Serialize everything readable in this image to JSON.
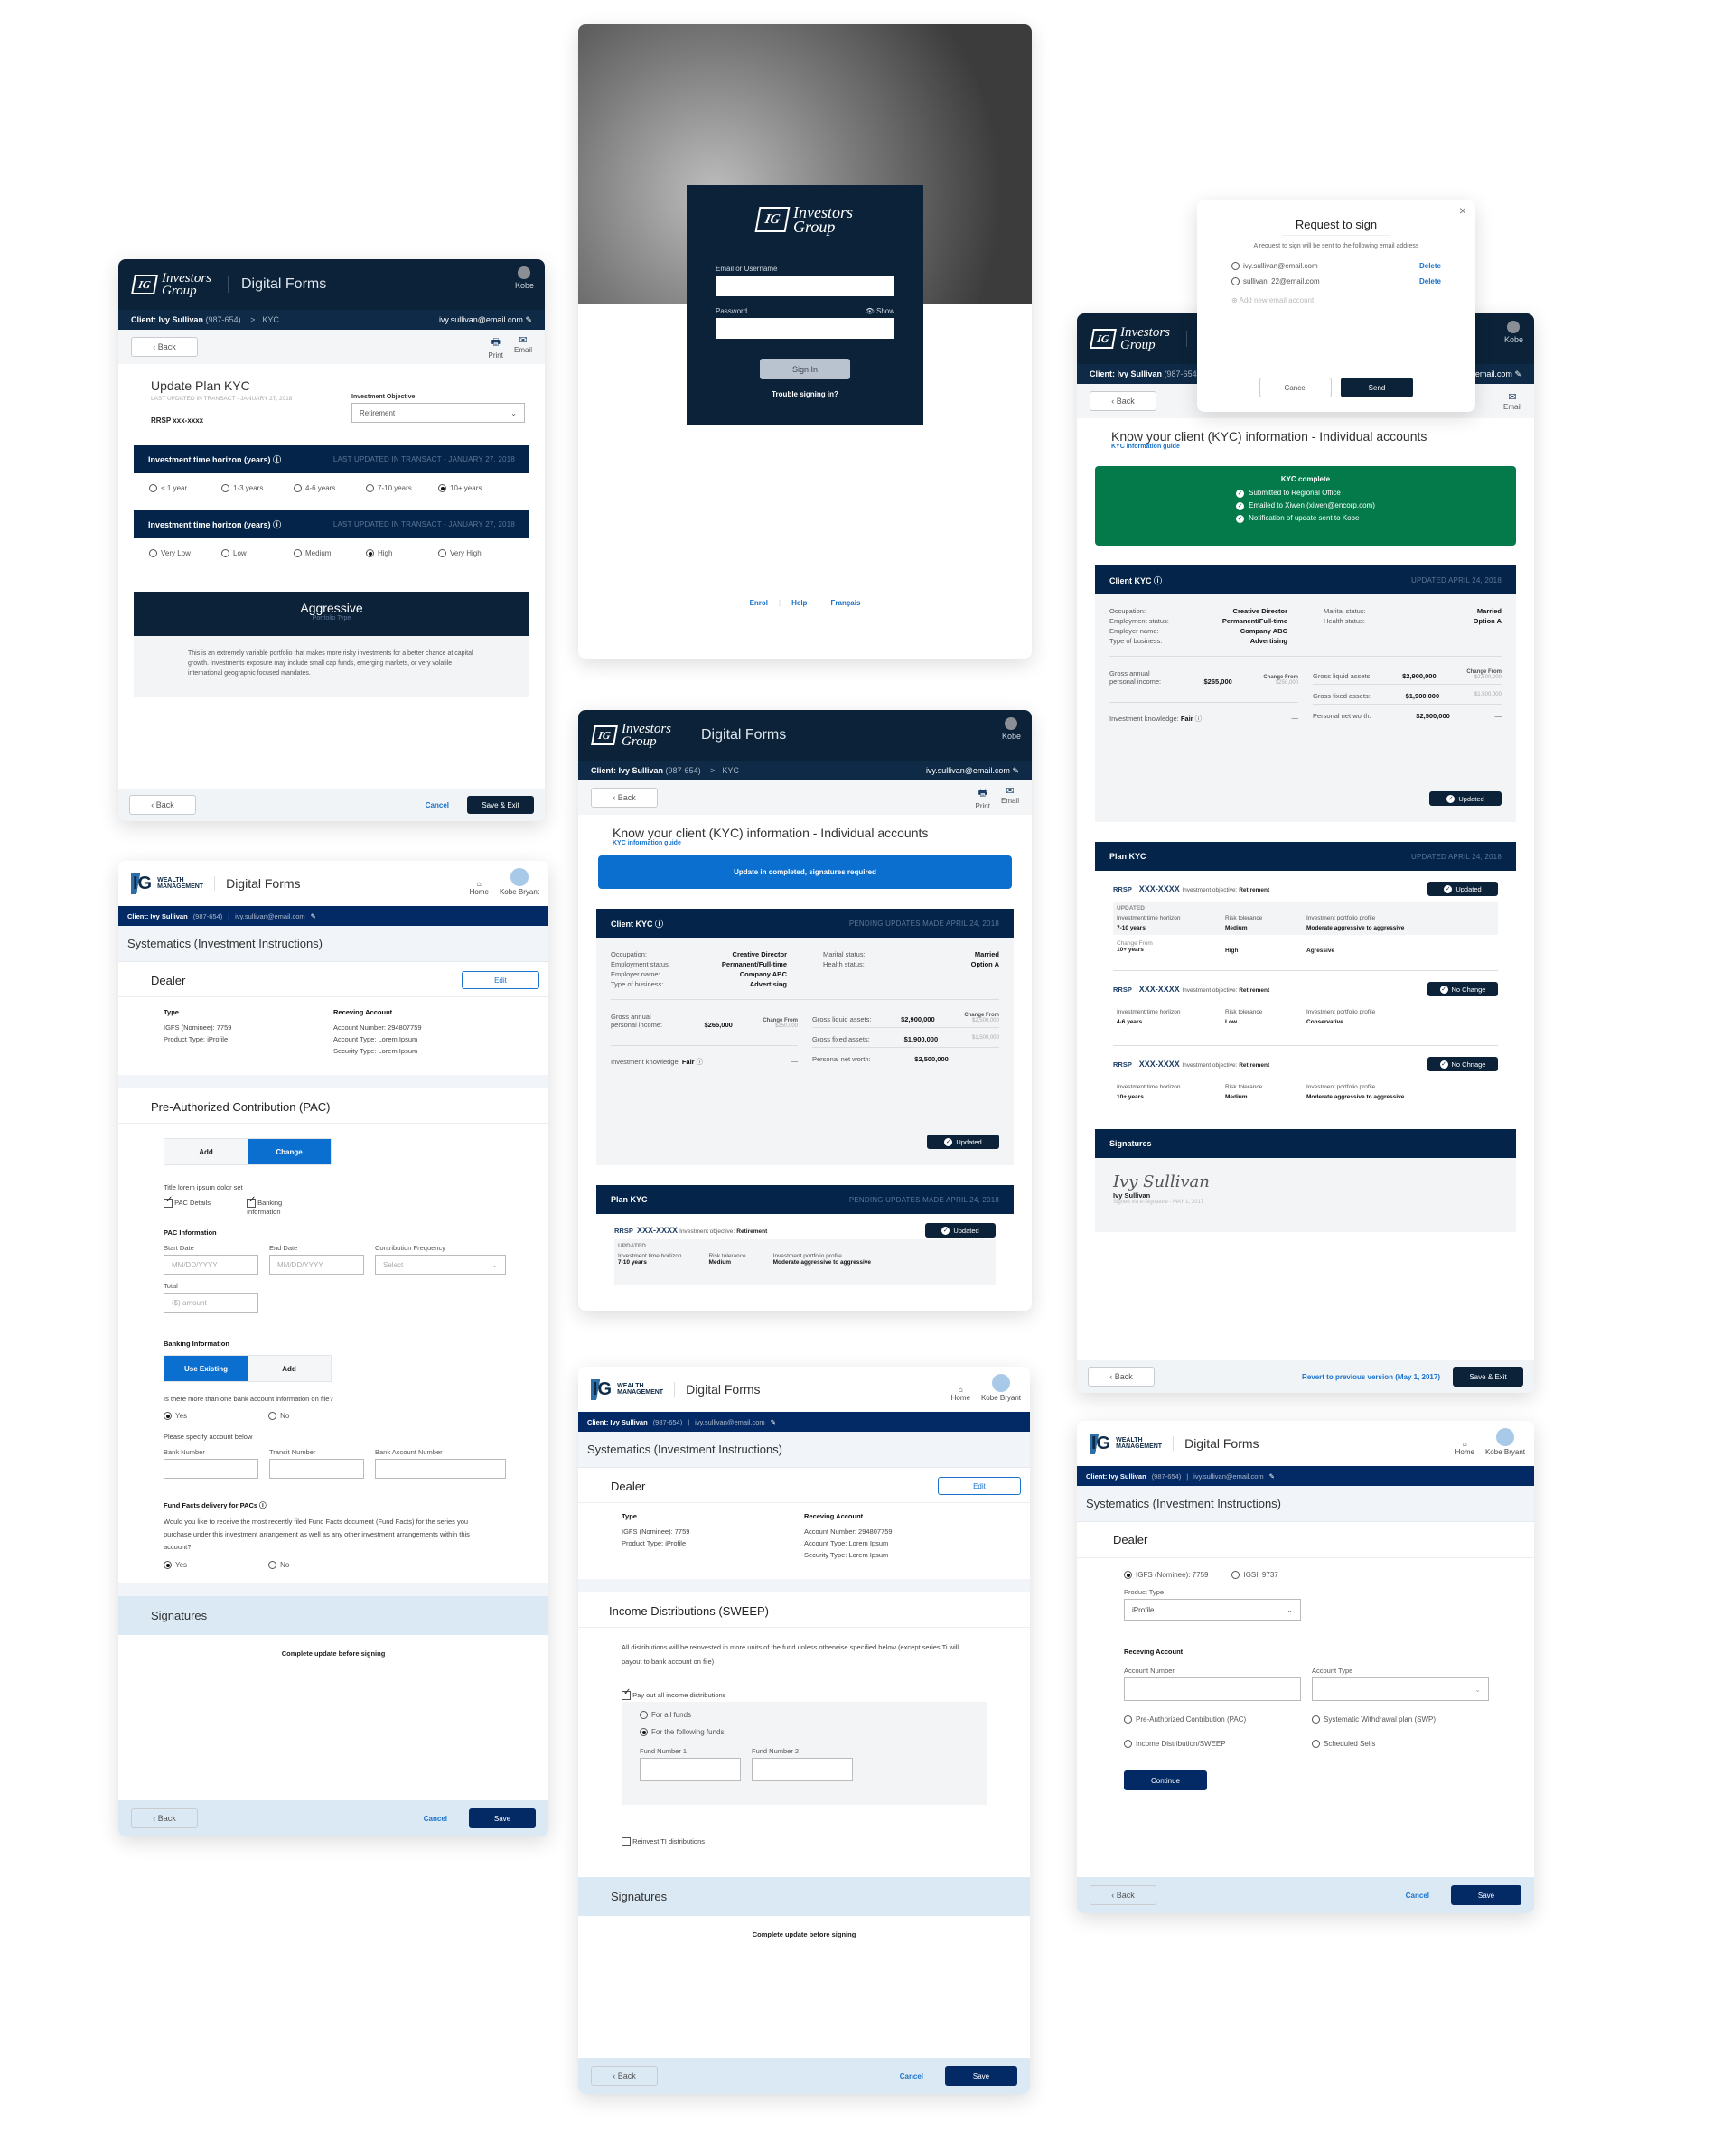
{
  "brand": {
    "ig_name_line1": "Investors",
    "ig_name_line2": "Group",
    "ig_mark": "IG",
    "wm_line1": "WEALTH",
    "wm_line2": "MANAGEMENT",
    "wm_mark": "IG",
    "app_title": "Digital Forms",
    "colors": {
      "navy": "#0b2238",
      "navy_bar": "#042549",
      "blue": "#0b6fcf",
      "green": "#047a4a",
      "link": "#1a72c9",
      "light_blue": "#dbe9f5"
    }
  },
  "common": {
    "user_short": "Kobe",
    "user_full": "Kobe Bryant",
    "home": "Home",
    "client_label": "Client: Ivy Sullivan",
    "client_id": "(987-654)",
    "breadcrumb_sep": ">",
    "breadcrumb_page": "KYC",
    "client_email": "ivy.sullivan@email.com",
    "back": "Back",
    "print": "Print",
    "email": "Email",
    "cancel": "Cancel",
    "save": "Save",
    "save_exit": "Save & Exit"
  },
  "update_plan": {
    "title": "Update Plan KYC",
    "subtitle": "LAST UPDATED IN TRANSACT - JANUARY 27, 2018",
    "account": "RRSP xxx-xxxx",
    "objective_label": "Investment Objective",
    "objective_value": "Retirement",
    "horizon_header": "Investment time horizon (years)",
    "horizon_date": "LAST UPDATED IN TRANSACT - JANUARY 27, 2018",
    "horizon_options": [
      "< 1 year",
      "1-3 years",
      "4-6 years",
      "7-10 years",
      "10+ years"
    ],
    "horizon_selected": 4,
    "risk_header": "Investment time horizon (years)",
    "risk_date": "LAST UPDATED IN TRANSACT - JANUARY 27, 2018",
    "risk_options": [
      "Very Low",
      "Low",
      "Medium",
      "High",
      "Very High"
    ],
    "risk_selected": 3,
    "portfolio_title": "Aggressive",
    "portfolio_sub": "Portfolio Type",
    "portfolio_desc": "This is an extremely variable portfolio that makes more risky investments for a better chance at capital growth. Investments exposure may include small cap funds, emerging markets, or very volatile international geographic focused mandates."
  },
  "login": {
    "email_label": "Email or Username",
    "email_value": "",
    "password_label": "Password",
    "password_value": "",
    "show": "Show",
    "sign_in": "Sign In",
    "trouble": "Trouble signing in?",
    "footer_links": [
      "Enrol",
      "Help",
      "Français"
    ]
  },
  "request_sign": {
    "title": "Request to sign",
    "desc": "A request to sign will be sent to the following email address",
    "emails": [
      "ivy.sullivan@email.com",
      "sullivan_22@email.com"
    ],
    "delete": "Delete",
    "add": "Add new email account",
    "cancel": "Cancel",
    "send": "Send"
  },
  "kyc": {
    "title": "Know your client (KYC) information - Individual accounts",
    "guide": "KYC information guide",
    "pending_banner": "Update in completed, signatures required",
    "complete_title": "KYC complete",
    "complete_items": [
      "Submitted to Regional Office",
      "Emailed to Xiwen (xiwen@encorp.com)",
      "Notification of update sent to Kobe"
    ],
    "client_kyc": "Client KYC",
    "pending_date": "PENDING UPDATES MADE APRIL 24, 2018",
    "updated_date": "UPDATED APRIL 24, 2018",
    "left_info": [
      {
        "k": "Occupation:",
        "v": "Creative Director"
      },
      {
        "k": "Employment status:",
        "v": "Permanent/Full-time"
      },
      {
        "k": "Employer name:",
        "v": "Company ABC"
      },
      {
        "k": "Type of business:",
        "v": "Advertising"
      }
    ],
    "right_info": [
      {
        "k": "Marital status:",
        "v": "Married"
      },
      {
        "k": "Health status:",
        "v": "Option A"
      }
    ],
    "change_from": "Change From",
    "income_label": "Gross annual personal income:",
    "income_value": "$265,000",
    "income_prev": "$250,000",
    "liquid_label": "Gross liquid assets:",
    "liquid_value": "$2,900,000",
    "liquid_prev": "$2,500,000",
    "fixed_label": "Gross fixed assets:",
    "fixed_value": "$1,900,000",
    "fixed_prev": "$1,500,000",
    "knowledge_label": "Investment knowledge:",
    "knowledge_value": "Fair",
    "networth_label": "Personal net worth:",
    "networth_value": "$2,500,000",
    "dash": "—",
    "updated_badge": "Updated",
    "plan_kyc": "Plan KYC",
    "plans": [
      {
        "type": "RRSP",
        "num": "XXX-XXXX",
        "obj_label": "Investment objective:",
        "obj": "Retirement",
        "badge": "Updated",
        "updated": "UPDATED",
        "horizon": "7-10 years",
        "risk": "Medium",
        "profile": "Moderate aggressive to aggressive",
        "change_label": "Change From",
        "prev_horizon": "10+ years",
        "prev_risk": "High",
        "prev_profile": "Agressive"
      },
      {
        "type": "RRSP",
        "num": "XXX-XXXX",
        "obj_label": "Investment objective:",
        "obj": "Retirement",
        "badge": "No Change",
        "horizon": "4-6 years",
        "risk": "Low",
        "profile": "Conservative"
      },
      {
        "type": "RRSP",
        "num": "XXX-XXXX",
        "obj_label": "Investment objective:",
        "obj": "Retirement",
        "badge": "No Chnage",
        "horizon": "10+ years",
        "risk": "Medium",
        "profile": "Moderate aggressive to aggressive"
      }
    ],
    "col_horizon": "Investment time horlizon",
    "col_risk": "Risk tolerance",
    "col_profile": "Investment portfolio profile",
    "signatures": "Signatures",
    "sig_script": "Ivy Sullivan",
    "sig_name": "Ivy Sullivan",
    "sig_meta": "Signed via e-Signature - MAY 1, 2017",
    "revert": "Revert to previous version (May 1, 2017)"
  },
  "systematics": {
    "title": "Systematics (Investment Instructions)",
    "dealer": "Dealer",
    "edit": "Edit",
    "type_h": "Type",
    "type_lines": [
      "IGFS (Nominee): 7759",
      "Product Type: iProfile"
    ],
    "recv_h": "Receving Account",
    "recv_lines": [
      "Account Number: 294807759",
      "Account Type: Lorem Ipsum",
      "Security Type: Lorem Ipsum"
    ],
    "pac_title": "Pre-Authorized Contribution (PAC)",
    "pac_seg": [
      "Add",
      "Change"
    ],
    "pac_sub": "Title lorem ipsum dolor set",
    "pac_checks": [
      "PAC Details",
      "Banking Information"
    ],
    "pac_info": "PAC Information",
    "start_label": "Start Date",
    "start_ph": "MM/DD/YYYY",
    "end_label": "End Date",
    "end_ph": "MM/DD/YYYY",
    "freq_label": "Contribution Frequency",
    "freq_ph": "Select",
    "total_label": "Total",
    "total_ph": "($) amount",
    "bank_info": "Banking Information",
    "bank_seg": [
      "Use Existing",
      "Add"
    ],
    "bank_q": "Is there more than one bank account information on file?",
    "yes": "Yes",
    "no": "No",
    "specify": "Please specify account below",
    "bank_num": "Bank Number",
    "transit": "Transit Number",
    "bank_acct": "Bank Account Number",
    "ff_title": "Fund Facts delivery for PACs",
    "ff_desc": "Would you like to receive the most recently filed Fund Facts document (Fund Facts) for the series you purchase under this investment arrangement as well as any other investment arrangements within this account?",
    "signatures": "Signatures",
    "complete_before": "Complete update before signing",
    "sweep_title": "Income Distributions (SWEEP)",
    "sweep_desc": "All distributions will be reinvested in more units of the fund unless otherwise specified below (except series Ti will payout to bank account on file)",
    "payout": "Pay out all income distributions",
    "for_all": "For all funds",
    "for_following": "For the following funds",
    "fund1": "Fund Number 1",
    "fund2": "Fund Number 2",
    "reinvest": "Reinvest TI distributions",
    "dealer_opts": [
      "IGFS (Nominee): 7759",
      "IGSI: 9737"
    ],
    "product_label": "Product Type",
    "product_value": "iProfile",
    "recv_title": "Receving Account",
    "acct_num_label": "Account Number",
    "acct_type_label": "Account Type",
    "instr_opts": [
      "Pre-Authorized Contribution (PAC)",
      "Systematic Withdrawal plan (SWP)",
      "Income Distribution/SWEEP",
      "Scheduled Sells"
    ],
    "continue": "Continue"
  }
}
